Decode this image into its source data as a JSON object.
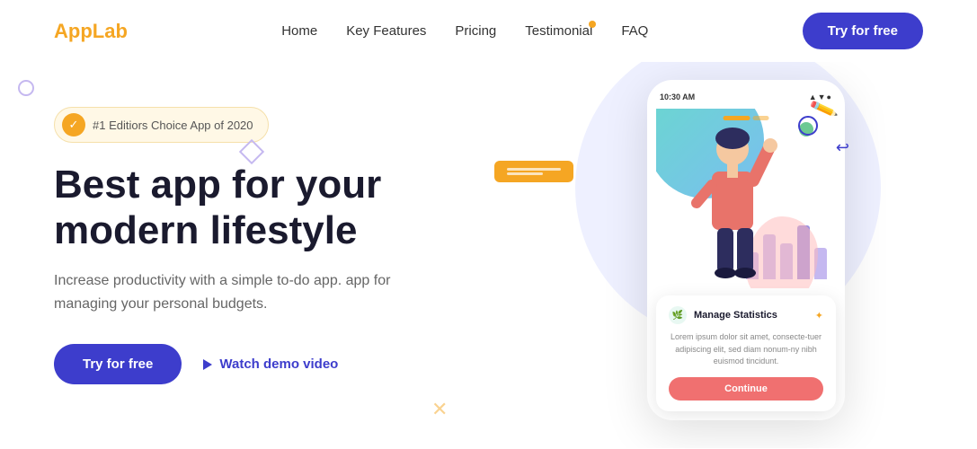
{
  "logo": {
    "app": "App",
    "lab": "Lab"
  },
  "nav": {
    "links": [
      {
        "label": "Home",
        "id": "home",
        "active": false
      },
      {
        "label": "Key Features",
        "id": "key-features",
        "active": false
      },
      {
        "label": "Pricing",
        "id": "pricing",
        "active": false
      },
      {
        "label": "Testimonial",
        "id": "testimonial",
        "active": true
      },
      {
        "label": "FAQ",
        "id": "faq",
        "active": false
      }
    ],
    "cta": "Try for free"
  },
  "hero": {
    "badge": "#1 Editiors Choice App of 2020",
    "title_line1": "Best app for your",
    "title_line2": "modern lifestyle",
    "subtitle": "Increase productivity with a simple to-do app. app for managing your personal budgets.",
    "cta_primary": "Try for free",
    "cta_secondary": "Watch demo video"
  },
  "phone": {
    "time": "10:30 AM",
    "status_icons": "▲ ▼ ●",
    "card": {
      "title": "Manage Statistics",
      "body": "Lorem ipsum dolor sit amet, consecte-tuer adipiscing elit, sed diam nonum-ny nibh euismod tincidunt.",
      "button": "Continue"
    }
  },
  "colors": {
    "accent": "#f5a623",
    "primary": "#3d3dcc",
    "danger": "#f07070",
    "text_dark": "#1a1a2e"
  }
}
